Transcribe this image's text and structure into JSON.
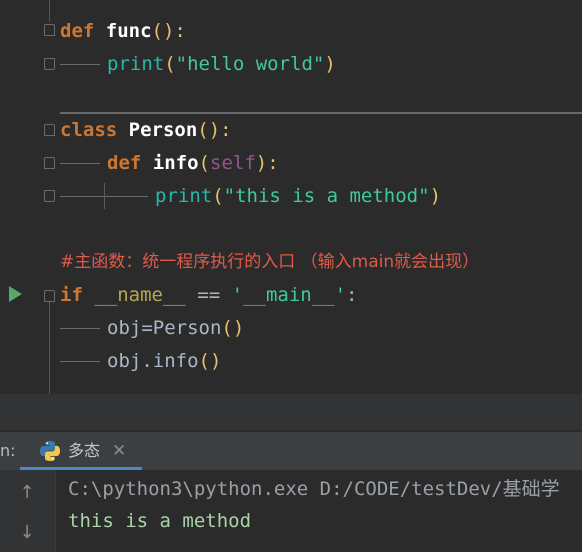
{
  "editor": {
    "line1": {
      "kw": "def",
      "name": "func",
      "paren": "():"
    },
    "line2": {
      "builtin": "print",
      "open": "(",
      "str": "\"hello world\"",
      "close": ")"
    },
    "line3": {
      "kw": "class",
      "name": "Person",
      "paren": "():"
    },
    "line4": {
      "kw": "def",
      "name": "info",
      "open": "(",
      "self": "self",
      "close": "):"
    },
    "line5": {
      "builtin": "print",
      "open": "(",
      "str": "\"this is a method\"",
      "close": ")"
    },
    "comment": "#主函数：统一程序执行的入口 （输入main就会出现）",
    "line7": {
      "kw": "if",
      "name": "__name__",
      "op": " == ",
      "str": "'__main__'",
      "colon": ":"
    },
    "line8": {
      "var": "obj",
      "eq": "=",
      "cls": "Person",
      "paren": "()"
    },
    "line9": {
      "var": "obj.info",
      "paren": "()"
    }
  },
  "run_panel": {
    "label": "n:",
    "tab_label": "多态",
    "tab_close": "✕",
    "tab_icon": "python-icon",
    "up_icon": "↑",
    "down_icon": "↓",
    "command": "C:\\python3\\python.exe D:/CODE/testDev/基础学",
    "output": "this is a method"
  },
  "colors": {
    "keyword": "#cc7832",
    "string": "#3fc9a0",
    "comment": "#e05a4a",
    "run_arrow": "#59a869",
    "tab_underline": "#4a88c7"
  }
}
